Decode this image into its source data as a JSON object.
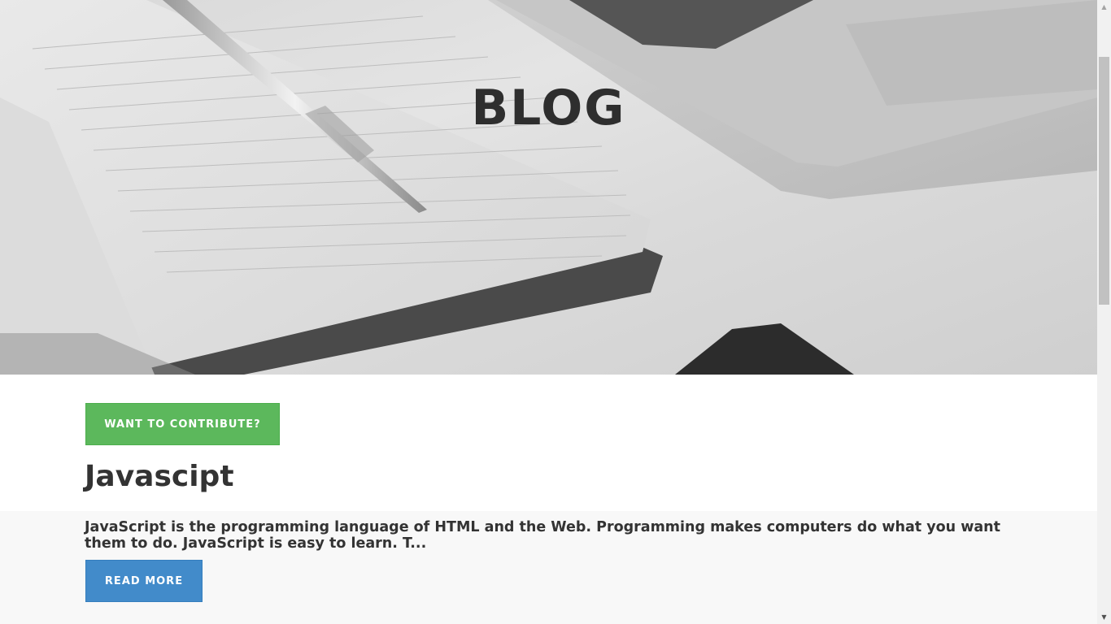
{
  "hero": {
    "title": "BLOG"
  },
  "actions": {
    "contribute_label": "WANT TO CONTRIBUTE?"
  },
  "post": {
    "title": "Javascipt",
    "excerpt": "JavaScript is the programming language of HTML and the Web. Programming makes computers do what you want them to do. JavaScript is easy to learn. T...",
    "read_more_label": "READ MORE"
  },
  "colors": {
    "contribute_button": "#5cb85c",
    "read_more_button": "#428bca",
    "heading_text": "#333333",
    "post_band": "#f8f8f8"
  },
  "icons": {
    "scroll_up": "triangle-up-icon",
    "scroll_down": "triangle-down-icon"
  }
}
